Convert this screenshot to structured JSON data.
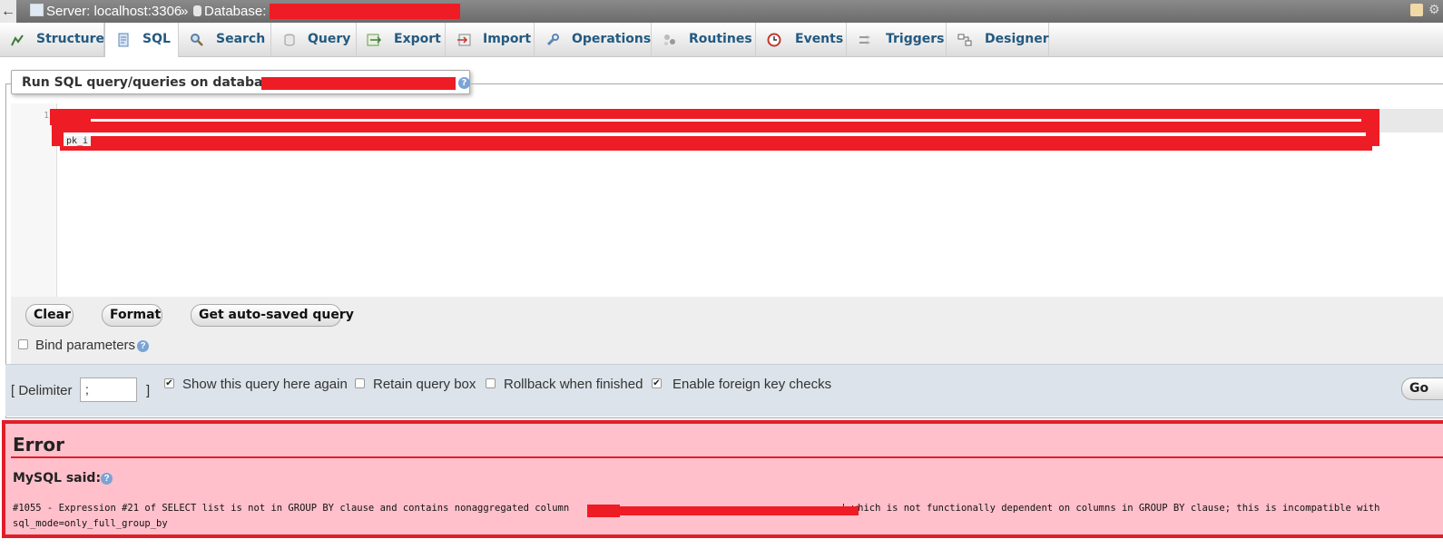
{
  "breadcrumb": {
    "back": "←",
    "server_label": "Server: localhost:3306",
    "separator": "»",
    "database_label": "Database:"
  },
  "tabs": [
    {
      "label": "Structure",
      "icon": "structure-icon"
    },
    {
      "label": "SQL",
      "icon": "sql-icon"
    },
    {
      "label": "Search",
      "icon": "search-icon"
    },
    {
      "label": "Query",
      "icon": "query-icon"
    },
    {
      "label": "Export",
      "icon": "export-icon"
    },
    {
      "label": "Import",
      "icon": "import-icon"
    },
    {
      "label": "Operations",
      "icon": "operations-icon"
    },
    {
      "label": "Routines",
      "icon": "routines-icon"
    },
    {
      "label": "Events",
      "icon": "events-icon"
    },
    {
      "label": "Triggers",
      "icon": "triggers-icon"
    },
    {
      "label": "Designer",
      "icon": "designer-icon"
    }
  ],
  "query_panel": {
    "legend": "Run SQL query/queries on database",
    "line_number": "1",
    "code_fragment": "pk_i"
  },
  "buttons": {
    "clear": "Clear",
    "format": "Format",
    "autosaved": "Get auto-saved query",
    "go": "Go"
  },
  "options": {
    "bind_parameters": "Bind parameters",
    "delimiter_label": "[ Delimiter",
    "delimiter_value": ";",
    "delimiter_close": "]",
    "show_query_again": "Show this query here again",
    "retain_query_box": "Retain query box",
    "rollback": "Rollback when finished",
    "foreign_key_checks": "Enable foreign key checks",
    "show_query_again_checked": true,
    "retain_query_box_checked": false,
    "rollback_checked": false,
    "foreign_key_checks_checked": true,
    "bind_parameters_checked": false
  },
  "error": {
    "title": "Error",
    "mysql_said": "MySQL said:",
    "message_part1": "#1055 - Expression #21 of SELECT list is not in GROUP BY clause and contains nonaggregated column",
    "message_part2": "' which is not functionally dependent on columns in GROUP BY clause; this is incompatible with",
    "message_part3": "sql_mode=only_full_group_by"
  },
  "colors": {
    "tab_text": "#235a81",
    "error_border": "#e01e2a",
    "error_bg": "#ffc0cb",
    "redaction": "#ee1c25"
  }
}
